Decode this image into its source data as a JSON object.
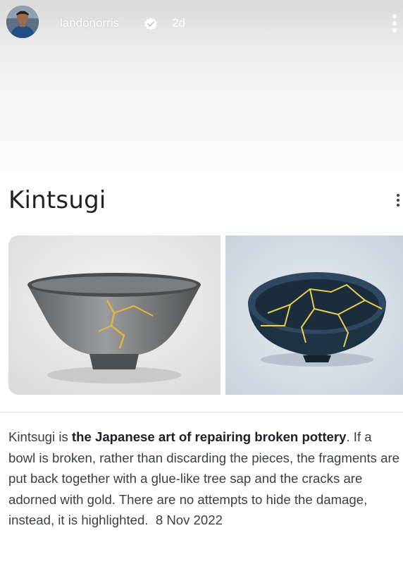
{
  "story": {
    "username": "landonorris",
    "time_ago": "2d",
    "verified_icon": "verified-badge-icon",
    "menu_icon": "more-vertical-icon"
  },
  "card": {
    "title": "Kintsugi",
    "menu_icon": "more-vertical-icon",
    "description": {
      "part1": "Kintsugi is ",
      "bold": "the Japanese art of repairing broken pottery",
      "part2": ". If a bowl is broken, rather than discarding the pieces, the fragments are put back together with a glue-like tree sap and the cracks are adorned with gold. There are no attempts to hide the damage, instead, it is highlighted.",
      "date": "8 Nov 2022"
    }
  },
  "colors": {
    "gold": "#e2b63a",
    "left_bowl": "#7d7f80",
    "right_bowl": "#23364a"
  }
}
